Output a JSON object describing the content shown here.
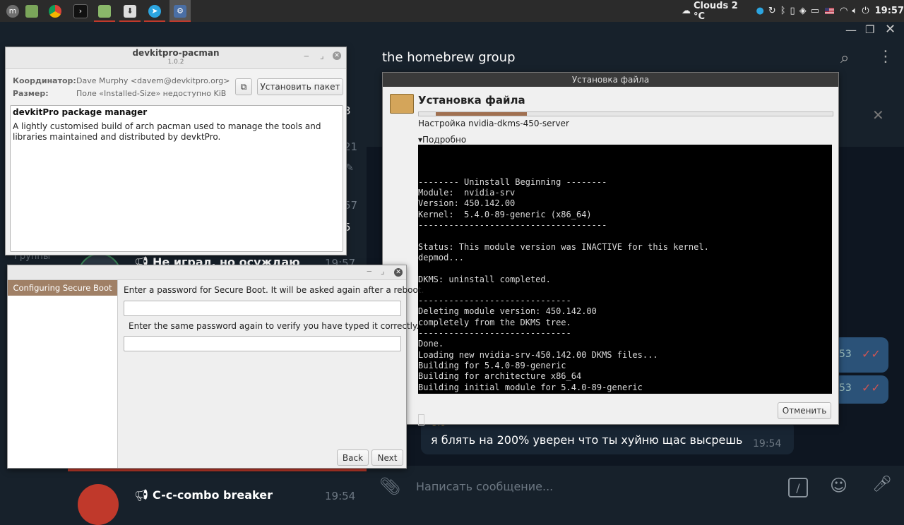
{
  "taskbar": {
    "apps": [
      "menu-icon",
      "files-icon",
      "chrome-icon",
      "terminal-icon",
      "folder-icon",
      "installer-icon",
      "telegram-icon",
      "settings-icon"
    ],
    "weather": "Clouds 2 °C",
    "clock": "19:57"
  },
  "telegram": {
    "chat_title": "the homebrew group",
    "left_fragments": {
      "n1": "3",
      "t1": "21",
      "t2": "57",
      "n2": "5",
      "groups": "Группы"
    },
    "chats": [
      {
        "name": "Не играл, но осуждаю",
        "time": "19:57"
      },
      {
        "name": "C-c-combo breaker",
        "time": "19:54"
      }
    ],
    "bubble_times": [
      "53",
      "53"
    ],
    "message": {
      "sender": "Ulo",
      "text": "я блять на 200% уверен что ты хуйню щас высрешь",
      "time": "19:54"
    },
    "compose_placeholder": "Написать сообщение...",
    "colors": {
      "accent": "#c0392b",
      "bg": "#0e1621"
    }
  },
  "pacman": {
    "title": "devkitpro-pacman",
    "version": "1.0.2",
    "maintainer_label": "Координатор:",
    "maintainer_value": "Dave Murphy <davem@devkitpro.org>",
    "size_label": "Размер:",
    "size_value": "Поле «Installed-Size» недоступно KiB",
    "install_button": "Установить пакет",
    "desc_title": "devkitPro package manager",
    "desc_text": "A lightly customised build of arch pacman used to manage the tools and libraries maintained and distributed by devktPro."
  },
  "secureboot": {
    "step": "Configuring Secure Boot",
    "prompt1": "Enter a password for Secure Boot. It will be asked again after a reboot.",
    "prompt2": "Enter the same password again to verify you have typed it correctly.",
    "back": "Back",
    "next": "Next"
  },
  "install": {
    "window_title": "Установка файла",
    "heading": "Установка файла",
    "status": "Настройка nvidia-dkms-450-server",
    "progress": 0.22,
    "details_toggle": "Подробно",
    "cancel": "Отменить",
    "terminal_lines": [
      "",
      "-------- Uninstall Beginning --------",
      "Module:  nvidia-srv",
      "Version: 450.142.00",
      "Kernel:  5.4.0-89-generic (x86_64)",
      "-------------------------------------",
      "",
      "Status: This module version was INACTIVE for this kernel.",
      "depmod...",
      "",
      "DKMS: uninstall completed.",
      "",
      "------------------------------",
      "Deleting module version: 450.142.00",
      "completely from the DKMS tree.",
      "------------------------------",
      "Done.",
      "Loading new nvidia-srv-450.142.00 DKMS files...",
      "Building for 5.4.0-89-generic",
      "Building for architecture x86_64",
      "Building initial module for 5.4.0-89-generic"
    ]
  }
}
